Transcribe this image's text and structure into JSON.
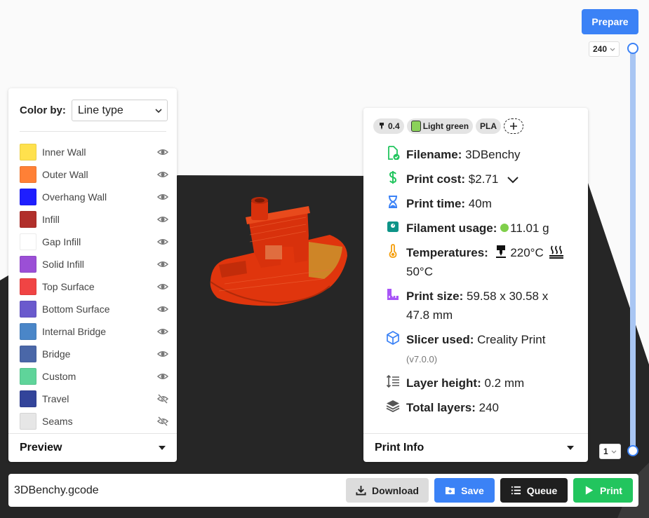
{
  "preview": {
    "color_by_label": "Color by:",
    "color_by_value": "Line type",
    "legend": [
      {
        "label": "Inner Wall",
        "color": "#ffe14d",
        "visible": true
      },
      {
        "label": "Outer Wall",
        "color": "#ff8036",
        "visible": true
      },
      {
        "label": "Overhang Wall",
        "color": "#1e1eff",
        "visible": true
      },
      {
        "label": "Infill",
        "color": "#b12f2b",
        "visible": true
      },
      {
        "label": "Gap Infill",
        "color": "#ffffff",
        "visible": true
      },
      {
        "label": "Solid Infill",
        "color": "#9b4fd6",
        "visible": true
      },
      {
        "label": "Top Surface",
        "color": "#f04444",
        "visible": true
      },
      {
        "label": "Bottom Surface",
        "color": "#6a5acd",
        "visible": true
      },
      {
        "label": "Internal Bridge",
        "color": "#4a86c8",
        "visible": true
      },
      {
        "label": "Bridge",
        "color": "#4a67a8",
        "visible": true
      },
      {
        "label": "Custom",
        "color": "#5fd49a",
        "visible": true
      },
      {
        "label": "Travel",
        "color": "#33449a",
        "visible": false
      },
      {
        "label": "Seams",
        "color": "#e6e6e6",
        "visible": false
      }
    ],
    "footer_title": "Preview"
  },
  "print_info": {
    "chips": {
      "nozzle": "0.4",
      "filament_color_name": "Light green",
      "material": "PLA"
    },
    "filename_label": "Filename:",
    "filename": "3DBenchy",
    "cost_label": "Print cost:",
    "cost": "$2.71",
    "time_label": "Print time:",
    "time": "40m",
    "filament_label": "Filament usage:",
    "filament": "11.01 g",
    "temps_label": "Temperatures:",
    "nozzle_temp": "220°C",
    "bed_temp": "50°C",
    "size_label": "Print size:",
    "size_line1": "59.58 x 30.58 x",
    "size_line2": "47.8 mm",
    "slicer_label": "Slicer used:",
    "slicer": "Creality Print",
    "slicer_version": "(v7.0.0)",
    "layer_height_label": "Layer height:",
    "layer_height": "0.2 mm",
    "total_layers_label": "Total layers:",
    "total_layers": "240",
    "footer_title": "Print Info"
  },
  "slider": {
    "prepare_label": "Prepare",
    "top_layer": "240",
    "bottom_layer": "1"
  },
  "bottom_bar": {
    "filename": "3DBenchy.gcode",
    "download_label": "Download",
    "save_label": "Save",
    "queue_label": "Queue",
    "print_label": "Print"
  },
  "colors": {
    "accent": "#3b82f6",
    "print": "#22c55e",
    "bed": "#262626",
    "model": "#e0350d"
  }
}
